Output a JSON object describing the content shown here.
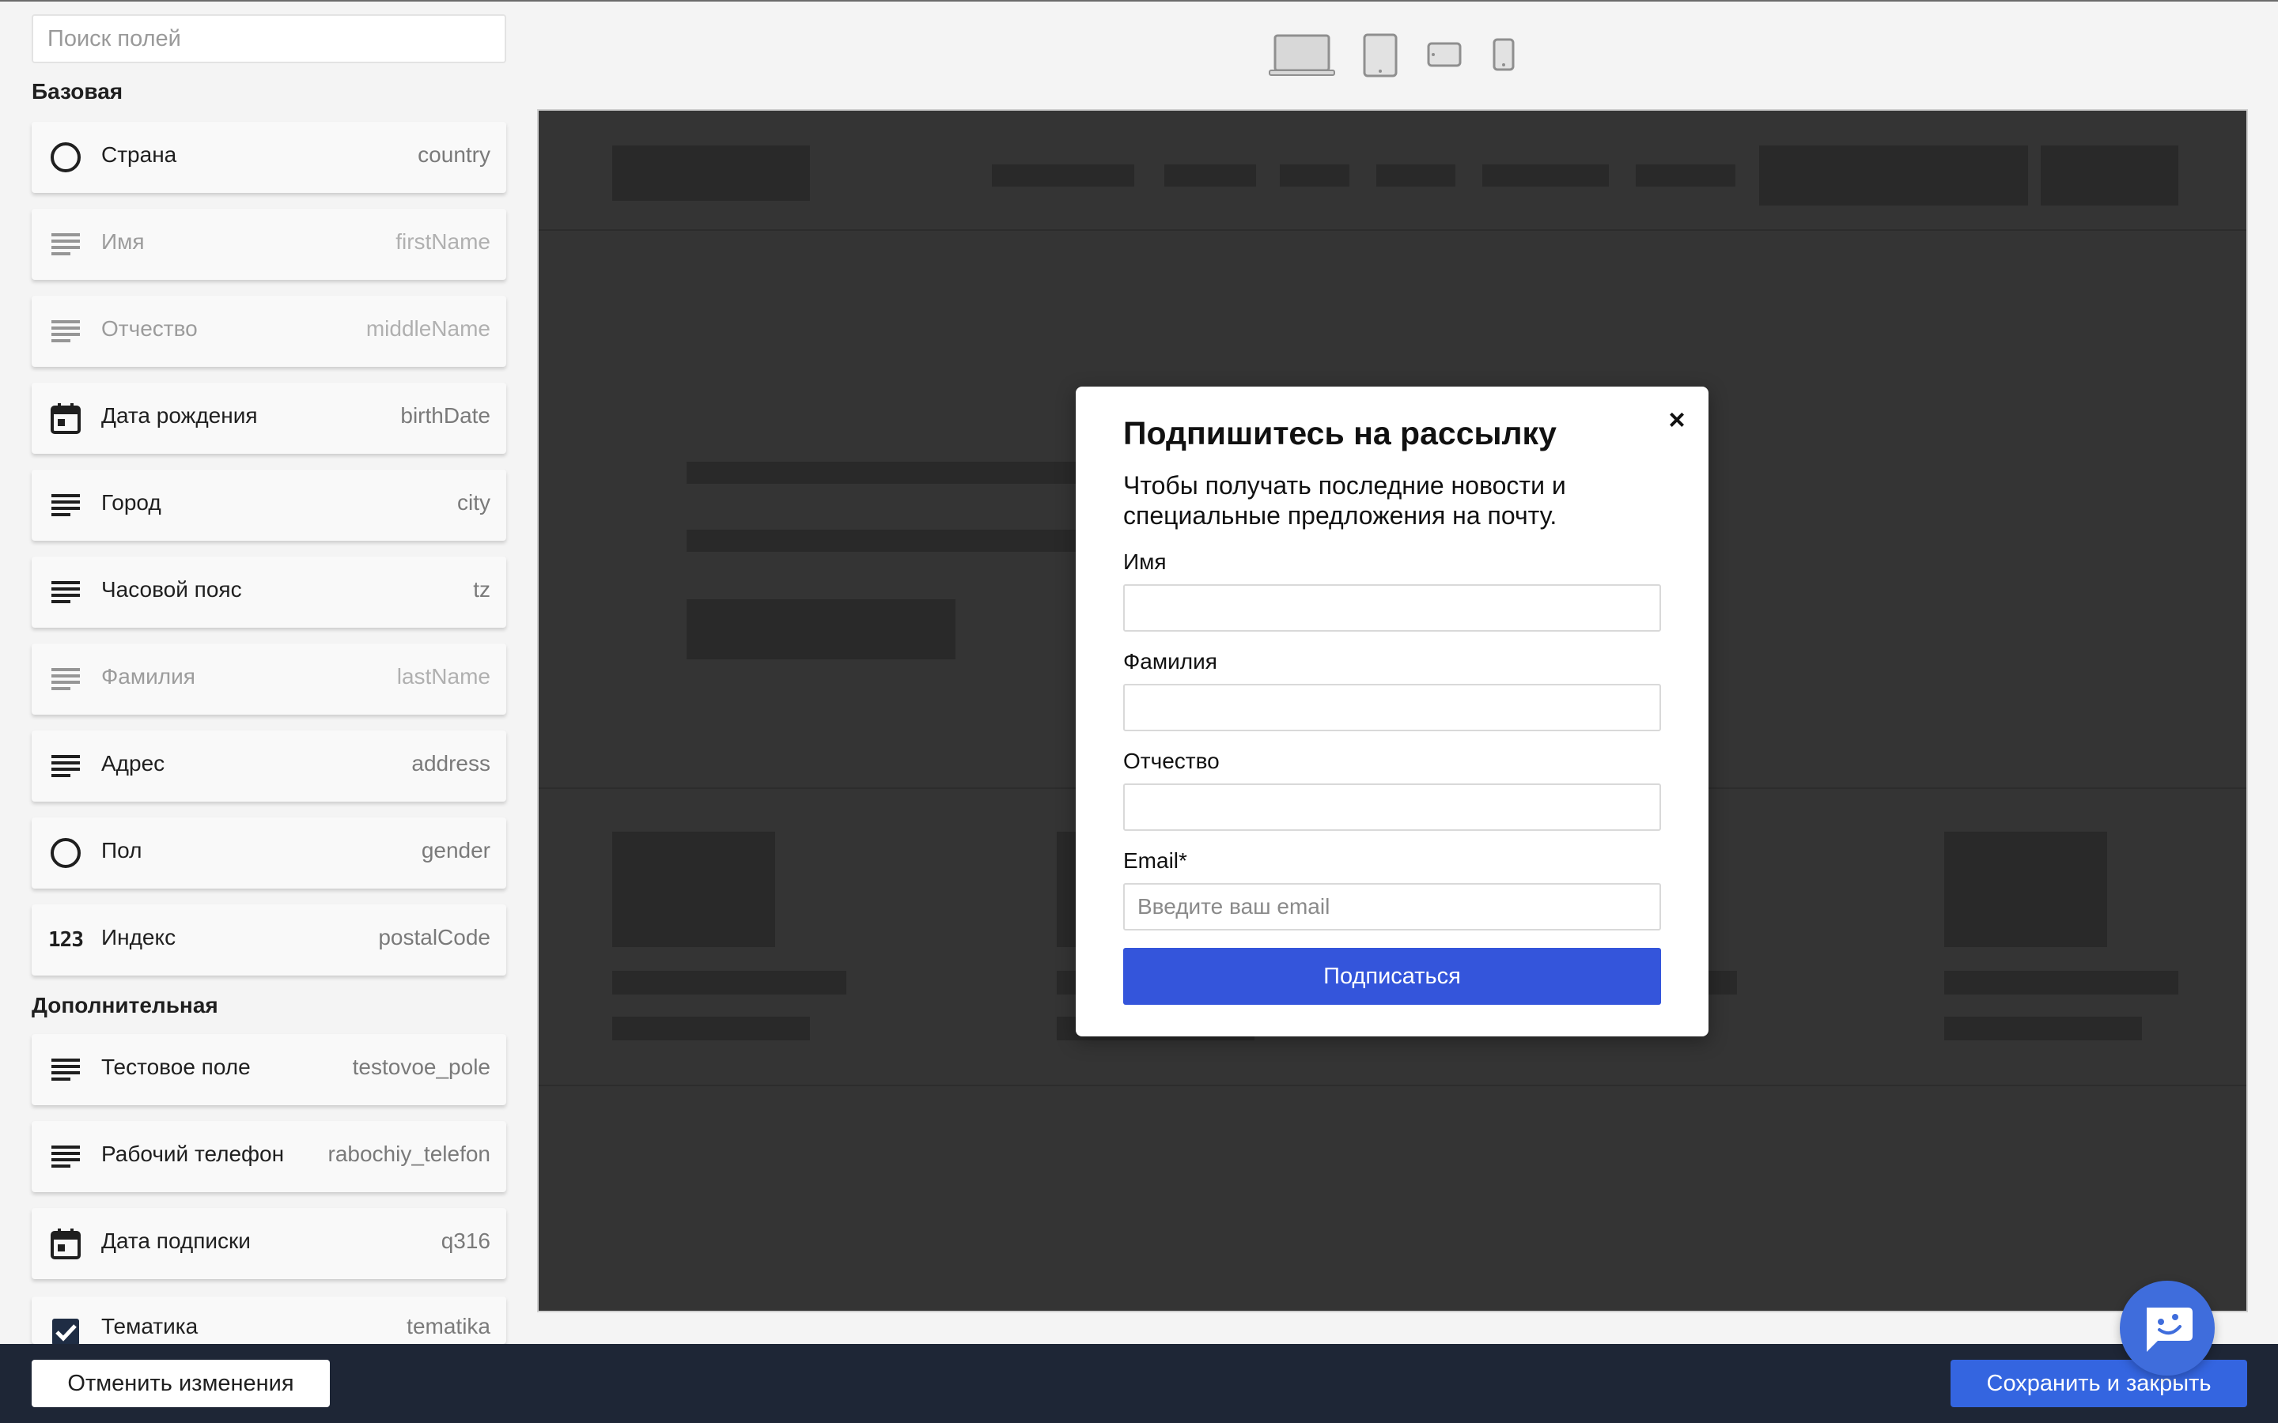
{
  "search": {
    "placeholder": "Поиск полей"
  },
  "sections": {
    "basic": "Базовая",
    "extra": "Дополнительная"
  },
  "basic_fields": [
    {
      "label": "Страна",
      "key": "country",
      "icon": "radio-icon",
      "dim": false
    },
    {
      "label": "Имя",
      "key": "firstName",
      "icon": "text-lines-icon",
      "dim": true
    },
    {
      "label": "Отчество",
      "key": "middleName",
      "icon": "text-lines-icon",
      "dim": true
    },
    {
      "label": "Дата рождения",
      "key": "birthDate",
      "icon": "calendar-icon",
      "dim": false
    },
    {
      "label": "Город",
      "key": "city",
      "icon": "text-lines-icon",
      "dim": false
    },
    {
      "label": "Часовой пояс",
      "key": "tz",
      "icon": "text-lines-icon",
      "dim": false
    },
    {
      "label": "Фамилия",
      "key": "lastName",
      "icon": "text-lines-icon",
      "dim": true
    },
    {
      "label": "Адрес",
      "key": "address",
      "icon": "text-lines-icon",
      "dim": false
    },
    {
      "label": "Пол",
      "key": "gender",
      "icon": "radio-icon",
      "dim": false
    },
    {
      "label": "Индекс",
      "key": "postalCode",
      "icon": "number-icon",
      "dim": false
    }
  ],
  "extra_fields": [
    {
      "label": "Тестовое поле",
      "key": "testovoe_pole",
      "icon": "text-lines-icon",
      "dim": false
    },
    {
      "label": "Рабочий телефон",
      "key": "rabochiy_telefon",
      "icon": "text-lines-icon",
      "dim": false
    },
    {
      "label": "Дата подписки",
      "key": "q316",
      "icon": "calendar-icon",
      "dim": false
    },
    {
      "label": "Тематика",
      "key": "tematika",
      "icon": "checkbox-icon",
      "dim": false
    }
  ],
  "number_icon_text": "123",
  "devices": [
    "desktop-icon",
    "tablet-portrait-icon",
    "tablet-landscape-icon",
    "mobile-icon"
  ],
  "modal": {
    "title": "Подпишитесь на рассылку",
    "subtitle": "Чтобы получать последние новости и специальные предложения на почту.",
    "close": "×",
    "fields": [
      {
        "label": "Имя",
        "placeholder": ""
      },
      {
        "label": "Фамилия",
        "placeholder": ""
      },
      {
        "label": "Отчество",
        "placeholder": ""
      },
      {
        "label": "Email*",
        "placeholder": "Введите ваш email"
      }
    ],
    "submit": "Подписаться"
  },
  "footer": {
    "cancel": "Отменить изменения",
    "save": "Сохранить и закрыть"
  },
  "colors": {
    "accent": "#3455db",
    "footer_bg": "#1e2636",
    "preview_bg": "#343434"
  }
}
